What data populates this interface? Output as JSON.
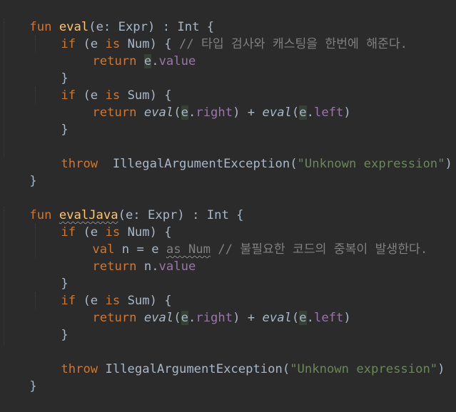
{
  "editor": {
    "theme_colors": {
      "background": "#2b2b2b",
      "keyword": "#cc7832",
      "function_decl": "#ffc66d",
      "property": "#9876aa",
      "string": "#6a8759",
      "comment": "#808080",
      "default": "#a9b7c6"
    },
    "lines": [
      {
        "id": "l1",
        "tokens": [
          [
            "kw",
            "fun"
          ],
          [
            "",
            "  "
          ],
          [
            "fn",
            "eval"
          ],
          [
            "",
            "(e: Expr) : Int {"
          ]
        ]
      },
      {
        "id": "l2",
        "tokens": [
          [
            "kw",
            "if"
          ],
          [
            "",
            ""
          ]
        ]
      },
      {
        "id": "l3"
      },
      {
        "id": "l4"
      }
    ]
  },
  "code": {
    "l1": {
      "kw": "fun",
      "name": "eval",
      "rest": "(e: Expr) : Int {"
    },
    "l2": {
      "kw": "if",
      "a": " (e ",
      "is": "is",
      "b": " Num) { ",
      "cmt": "// 타입 검사와 캐스팅을 한번에 해준다."
    },
    "l3": {
      "kw": "return",
      "obj": "e",
      "dot": ".",
      "prop": "value"
    },
    "l4": {
      "text": "}"
    },
    "l5": {
      "kw": "if",
      "a": " (e ",
      "is": "is",
      "b": " Sum) {"
    },
    "l6": {
      "kw": "return",
      "call1": "eval",
      "p1": "(",
      "obj1": "e",
      "dot1": ".",
      "prop1": "right",
      "mid": ") + ",
      "call2": "eval",
      "p2": "(",
      "obj2": "e",
      "dot2": ".",
      "prop2": "left",
      "end": ")"
    },
    "l7": {
      "text": "}"
    },
    "l9": {
      "kw": "throw",
      "gap": "  IllegalArgumentException(",
      "str": "\"Unknown expression\"",
      "end": ")"
    },
    "l10": {
      "text": "}"
    },
    "l12": {
      "kw": "fun",
      "name": "evalJava",
      "rest": "(e: Expr) : Int {"
    },
    "l13": {
      "kw": "if",
      "a": " (e ",
      "is": "is",
      "b": " Num) {"
    },
    "l14": {
      "kw": "val",
      "a": " n = e ",
      "as": "as",
      "b": " Num",
      "c": " ",
      "cmt": "// 불필요한 코드의 중복이 발생한다."
    },
    "l15": {
      "kw": "return",
      "a": " n.",
      "prop": "value"
    },
    "l16": {
      "text": "}"
    },
    "l17": {
      "kw": "if",
      "a": " (e ",
      "is": "is",
      "b": " Sum) {"
    },
    "l18": {
      "kw": "return",
      "call1": "eval",
      "p1": "(",
      "obj1": "e",
      "dot1": ".",
      "prop1": "right",
      "mid": ") + ",
      "call2": "eval",
      "p2": "(",
      "obj2": "e",
      "dot2": ".",
      "prop2": "left",
      "end": ")"
    },
    "l19": {
      "text": "}"
    },
    "l21": {
      "kw": "throw",
      "gap": " IllegalArgumentException(",
      "str": "\"Unknown expression\"",
      "end": ")"
    },
    "l22": {
      "text": "}"
    }
  }
}
